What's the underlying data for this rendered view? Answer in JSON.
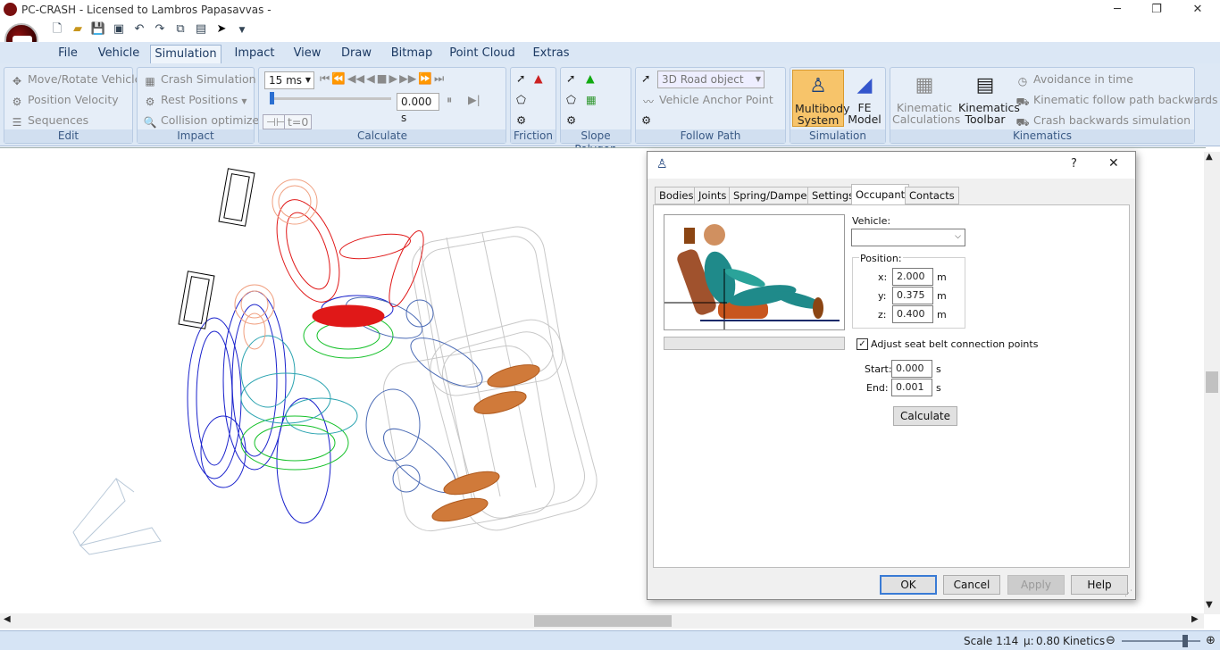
{
  "window": {
    "title": "PC-CRASH - Licensed to Lambros Papasavvas -",
    "minimize": "─",
    "restore": "❐",
    "close": "✕"
  },
  "menu": {
    "tabs": [
      "File",
      "Vehicle",
      "Simulation",
      "Impact",
      "View",
      "Draw",
      "Bitmap",
      "Point Cloud",
      "Extras"
    ],
    "active": "Simulation"
  },
  "ribbon": {
    "edit": {
      "label": "Edit",
      "items": [
        "Move/Rotate Vehicle",
        "Position  Velocity",
        "Sequences"
      ]
    },
    "impact": {
      "label": "Impact",
      "items": [
        "Crash Simulation",
        "Rest Positions",
        "Collision optimizer"
      ]
    },
    "calculate": {
      "label": "Calculate",
      "timestep": "15 ms",
      "time": "0.000 s",
      "t0": "t=0"
    },
    "friction": {
      "label": "Friction"
    },
    "slope": {
      "label": "Slope Polygon"
    },
    "followpath": {
      "label": "Follow Path",
      "road_object": "3D Road object",
      "anchor": "Vehicle Anchor Point"
    },
    "simulation": {
      "label": "Simulation",
      "multibody": "Multibody System",
      "fe": "FE Model"
    },
    "kinematics": {
      "label": "Kinematics",
      "calc": "Kinematic Calculations",
      "toolbar": "Kinematics Toolbar",
      "items": [
        "Avoidance in time",
        "Kinematic follow path backwards",
        "Crash backwards simulation"
      ]
    }
  },
  "dialog": {
    "help": "?",
    "close": "✕",
    "tabs": [
      "Bodies",
      "Joints",
      "Spring/Dampers",
      "Settings",
      "Occupant",
      "Contacts"
    ],
    "active_tab": "Occupant",
    "vehicle_label": "Vehicle:",
    "vehicle_value": "",
    "position_label": "Position:",
    "x_label": "x:",
    "x": "2.000",
    "y_label": "y:",
    "y": "0.375",
    "z_label": "z:",
    "z": "0.400",
    "unit_m": "m",
    "seatbelt_label": "Adjust seat belt connection points",
    "seatbelt_checked": true,
    "start_label": "Start:",
    "start": "0.000",
    "end_label": "End:",
    "end": "0.001",
    "unit_s": "s",
    "calculate": "Calculate",
    "ok": "OK",
    "cancel": "Cancel",
    "apply": "Apply",
    "help_btn": "Help"
  },
  "status": {
    "scale_label": "Scale 1:",
    "scale": "14",
    "mu_label": "µ:",
    "mu": "0.80",
    "mode": "Kinetics"
  }
}
